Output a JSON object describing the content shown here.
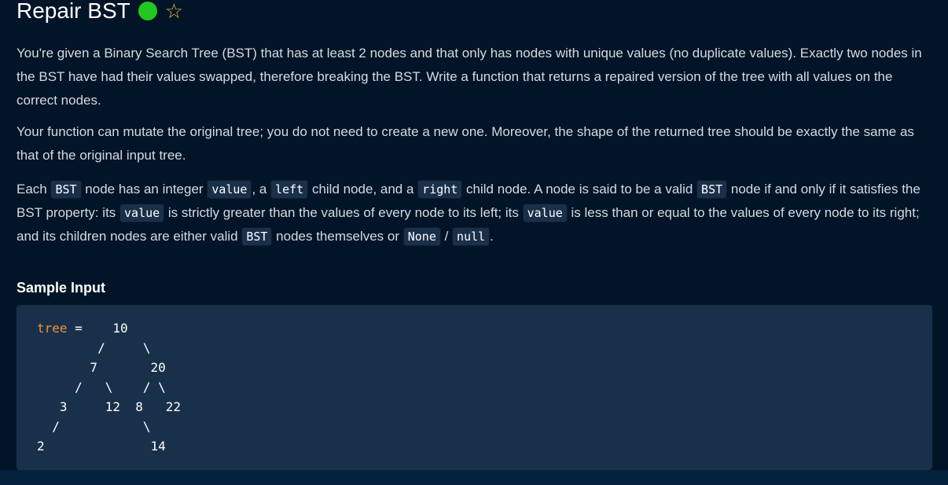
{
  "title": "Repair BST",
  "status_color": "#22c722",
  "paragraphs": {
    "p1": "You're given a Binary Search Tree (BST) that has at least 2 nodes and that only has nodes with unique values (no duplicate values). Exactly two nodes in the BST have had their values swapped, therefore breaking the BST. Write a function that returns a repaired version of the tree with all values on the correct nodes.",
    "p2": "Your function can mutate the original tree; you do not need to create a new one. Moreover, the shape of the returned tree should be exactly the same as that of the original input tree.",
    "p3": [
      "Each ",
      "BST",
      " node has an integer ",
      "value",
      ", a ",
      "left",
      " child node, and a ",
      "right",
      " child node. A node is said to be a valid ",
      "BST",
      " node if and only if it satisfies the BST property: its ",
      "value",
      " is strictly greater than the values of every node to its left; its ",
      "value",
      " is less than or equal to the values of every node to its right; and its children nodes are either valid ",
      "BST",
      " nodes themselves or ",
      "None",
      " / ",
      "null",
      "."
    ]
  },
  "sample_input": {
    "heading": "Sample Input",
    "var_name": "tree",
    "assign": " =    10",
    "lines": [
      "        /     \\",
      "       7       20",
      "     /   \\    / \\",
      "   3     12  8   22",
      "  /           \\",
      "2              14"
    ]
  }
}
